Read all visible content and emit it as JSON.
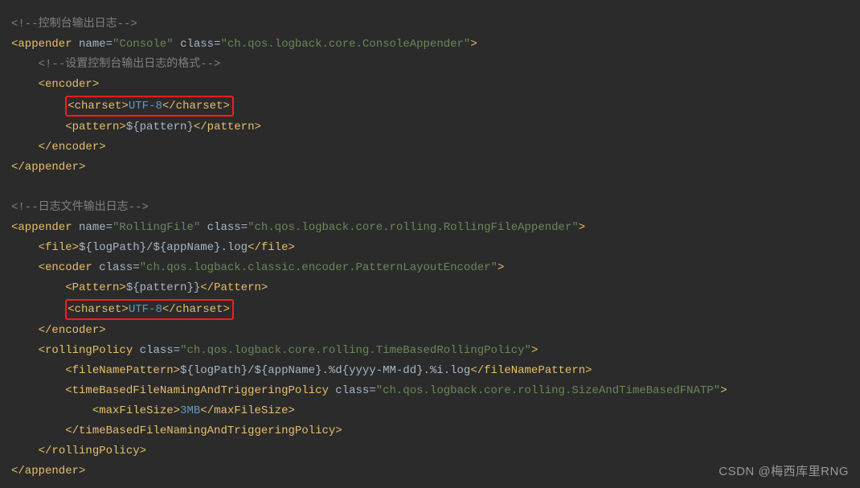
{
  "block1": {
    "comment1": "<!--控制台输出日志-->",
    "appender": {
      "open_prefix": "<appender ",
      "attr_name_lbl": "name",
      "name_val": "\"Console\"",
      "attr_class_lbl": "class",
      "class_val": "\"ch.qos.logback.core.ConsoleAppender\"",
      "close": ">"
    },
    "comment2": "<!--设置控制台输出日志的格式-->",
    "encoder_open": "<encoder>",
    "charset_open": "<charset>",
    "charset_val": "UTF-8",
    "charset_close": "</charset>",
    "pattern_open": "<pattern>",
    "pattern_val": "${pattern}",
    "pattern_close": "</pattern>",
    "encoder_close": "</encoder>",
    "appender_close": "</appender>"
  },
  "block2": {
    "comment1": "<!--日志文件输出日志-->",
    "appender": {
      "open_prefix": "<appender ",
      "attr_name_lbl": "name",
      "name_val": "\"RollingFile\"",
      "attr_class_lbl": "class",
      "class_val": "\"ch.qos.logback.core.rolling.RollingFileAppender\"",
      "close": ">"
    },
    "file_open": "<file>",
    "file_val": "${logPath}/${appName}.log",
    "file_close": "</file>",
    "encoder_open_prefix": "<encoder ",
    "encoder_class_lbl": "class",
    "encoder_class_val": "\"ch.qos.logback.classic.encoder.PatternLayoutEncoder\"",
    "encoder_open_close": ">",
    "pattern_open": "<Pattern>",
    "pattern_val": "${pattern}}",
    "pattern_close": "</Pattern>",
    "charset_open": "<charset>",
    "charset_val": "UTF-8",
    "charset_close": "</charset>",
    "encoder_close": "</encoder>",
    "rolling_open_prefix": "<rollingPolicy ",
    "rolling_class_lbl": "class",
    "rolling_class_val": "\"ch.qos.logback.core.rolling.TimeBasedRollingPolicy\"",
    "rolling_open_close": ">",
    "fnp_open": "<fileNamePattern>",
    "fnp_val": "${logPath}/${appName}.%d{yyyy-MM-dd}.%i.log",
    "fnp_close": "</fileNamePattern>",
    "tb_open_prefix": "<timeBasedFileNamingAndTriggeringPolicy ",
    "tb_class_lbl": "class",
    "tb_class_val": "\"ch.qos.logback.core.rolling.SizeAndTimeBasedFNATP\"",
    "tb_open_close": ">",
    "max_open": "<maxFileSize>",
    "max_val": "3MB",
    "max_close": "</maxFileSize>",
    "tb_close": "</timeBasedFileNamingAndTriggeringPolicy>",
    "rolling_close": "</rollingPolicy>",
    "appender_close": "</appender>"
  },
  "watermark": "CSDN @梅西库里RNG"
}
